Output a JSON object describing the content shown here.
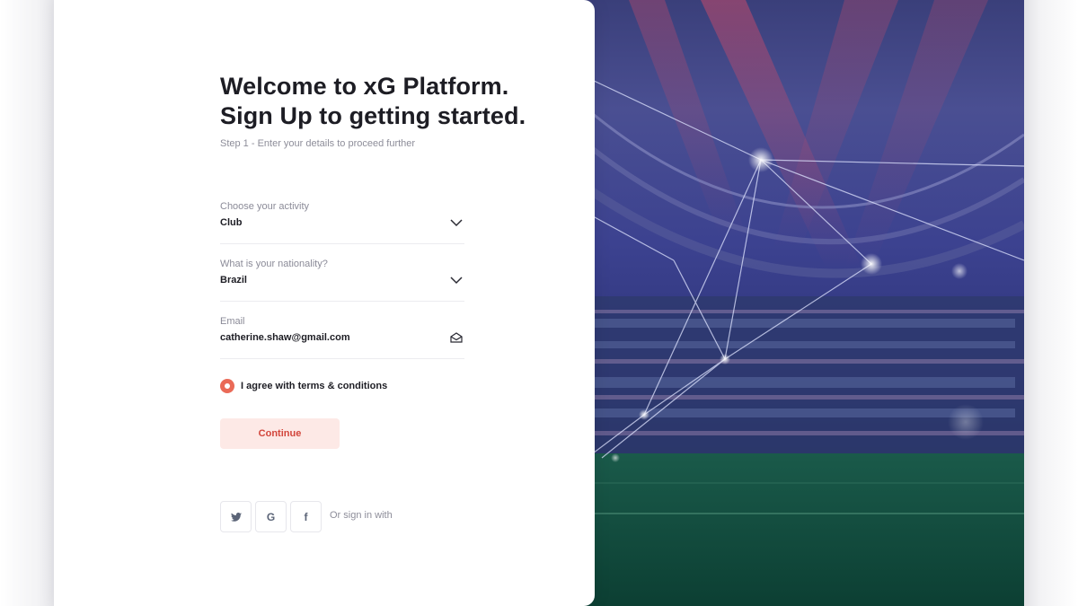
{
  "signup": {
    "title_line1": "Welcome to xG Platform.",
    "title_line2": "Sign Up to getting started.",
    "step_text": "Step 1 - Enter your details to proceed further"
  },
  "fields": {
    "activity": {
      "label": "Choose your activity",
      "value": "Club",
      "icon": "chevron-down-icon"
    },
    "nationality": {
      "label": "What is your nationality?",
      "value": "Brazil",
      "icon": "chevron-down-icon"
    },
    "email": {
      "label": "Email",
      "value": "catherine.shaw@gmail.com",
      "icon": "mail-open-icon"
    }
  },
  "terms": {
    "label": "I agree with terms & conditions",
    "checked": true
  },
  "continue_label": "Continue",
  "social": {
    "text": "Or sign in with",
    "twitter_icon": "twitter-icon",
    "google_glyph": "G",
    "facebook_glyph": "f"
  },
  "colors": {
    "accent": "#ea6a57",
    "button_bg": "#fde9e6",
    "button_text": "#d2453b",
    "heading": "#1d1d24",
    "muted": "#8d8d99"
  }
}
